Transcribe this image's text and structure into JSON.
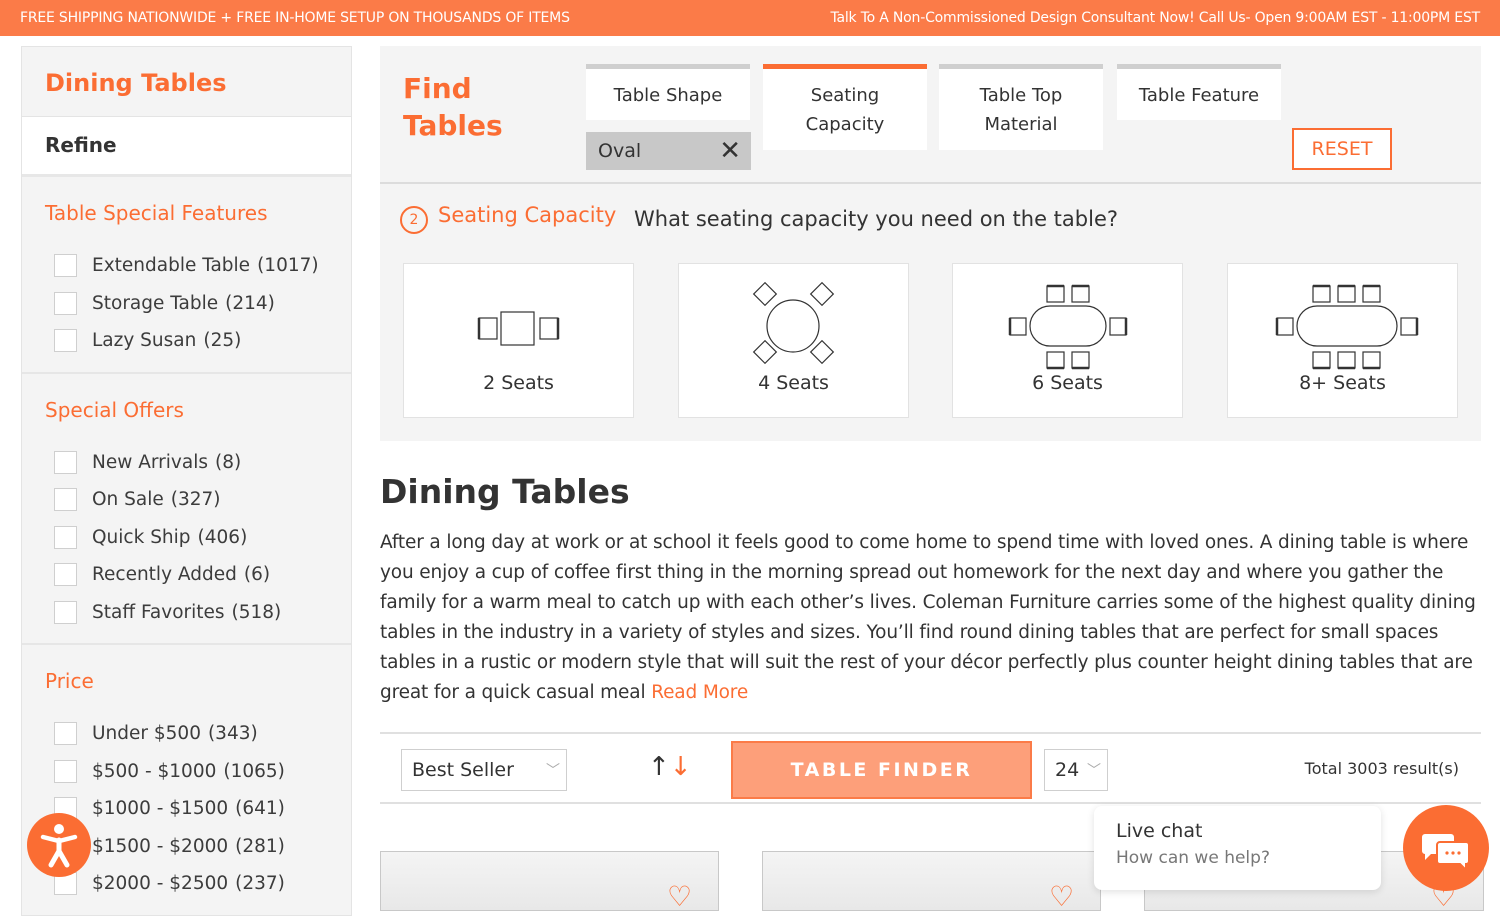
{
  "topbar": {
    "left_text": "FREE SHIPPING NATIONWIDE + FREE IN-HOME SETUP ON THOUSANDS OF ITEMS",
    "right_text": "Talk To A Non-Commissioned Design Consultant Now! Call Us- Open 9:00AM EST - 11:00PM EST"
  },
  "sidebar": {
    "title": "Dining Tables",
    "refine_label": "Refine",
    "facets": [
      {
        "title": "Table Special Features",
        "items": [
          {
            "label": "Extendable Table",
            "count": "(1017)"
          },
          {
            "label": "Storage Table",
            "count": "(214)"
          },
          {
            "label": "Lazy Susan",
            "count": "(25)"
          }
        ]
      },
      {
        "title": "Special Offers",
        "items": [
          {
            "label": "New Arrivals",
            "count": "(8)"
          },
          {
            "label": "On Sale",
            "count": "(327)"
          },
          {
            "label": "Quick Ship",
            "count": "(406)"
          },
          {
            "label": "Recently Added",
            "count": "(6)"
          },
          {
            "label": "Staff Favorites",
            "count": "(518)"
          }
        ]
      },
      {
        "title": "Price",
        "items": [
          {
            "label": "Under $500",
            "count": "(343)"
          },
          {
            "label": "$500 - $1000",
            "count": "(1065)"
          },
          {
            "label": "$1000 - $1500",
            "count": "(641)"
          },
          {
            "label": "$1500 - $2000",
            "count": "(281)"
          },
          {
            "label": "$2000 - $2500",
            "count": "(237)"
          }
        ]
      }
    ]
  },
  "finder": {
    "title_line1": "Find",
    "title_line2": "Tables",
    "tabs": [
      {
        "label": "Table Shape",
        "active": false
      },
      {
        "label": "Seating Capacity",
        "active": true
      },
      {
        "label": "Table Top Material",
        "active": false
      },
      {
        "label": "Table Feature",
        "active": false
      }
    ],
    "selected_chip": "Oval",
    "reset_label": "RESET",
    "step_number": "2",
    "step_label": "Seating Capacity",
    "step_question": "What seating capacity you need on the table?",
    "options": [
      {
        "label": "2 Seats",
        "icon": "two-seat-table-icon"
      },
      {
        "label": "4 Seats",
        "icon": "four-seat-table-icon"
      },
      {
        "label": "6 Seats",
        "icon": "six-seat-table-icon"
      },
      {
        "label": "8+ Seats",
        "icon": "eight-seat-table-icon"
      }
    ]
  },
  "content": {
    "heading": "Dining Tables",
    "description": "After a long day at work or at school it feels good to come home to spend time with loved ones. A dining table is where you enjoy a cup of coffee first thing in the morning spread out homework for the next day and where you gather the family for a warm meal to catch up with each other’s lives. Coleman Furniture carries some of the highest quality dining tables in the industry in a variety of styles and sizes. You’ll find round dining tables that are perfect for small spaces tables in a rustic or modern style that will suit the rest of your décor perfectly plus counter height dining tables that are great for a quick casual meal",
    "read_more": "Read More"
  },
  "toolbar": {
    "sort_value": "Best Seller",
    "finder_button": "TABLE FINDER",
    "per_page_value": "24",
    "total": "Total 3003 result(s)"
  },
  "chat": {
    "title": "Live chat",
    "subtitle": "How can we help?"
  },
  "colors": {
    "accent": "#fb6d33",
    "topbar": "#fb7b48",
    "finder_button": "#fd9f7a"
  }
}
